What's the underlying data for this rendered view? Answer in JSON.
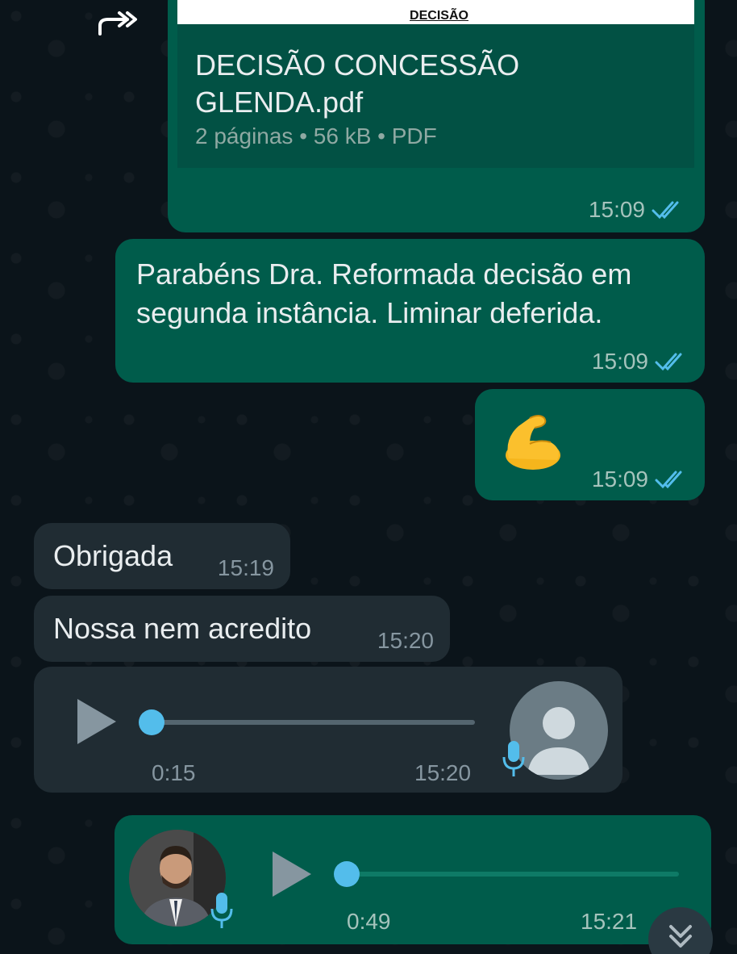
{
  "messages": {
    "document": {
      "preview_title": "DECISÃO",
      "file_name": "DECISÃO CONCESSÃO GLENDA.pdf",
      "meta": "2 páginas • 56 kB • PDF",
      "time": "15:09"
    },
    "text1": {
      "text": "Parabéns Dra. Reformada decisão em segunda instância. Liminar deferida.",
      "time": "15:09"
    },
    "emoji": {
      "emoji_name": "flexed-biceps",
      "time": "15:09"
    },
    "obrigada": {
      "text": "Obrigada",
      "time": "15:19"
    },
    "nossa": {
      "text": "Nossa nem acredito",
      "time": "15:20"
    },
    "voice_in": {
      "duration": "0:15",
      "time": "15:20",
      "progress": 0.0
    },
    "voice_out": {
      "duration": "0:49",
      "time": "15:21",
      "progress": 0.0
    }
  },
  "colors": {
    "outgoing_bubble": "#005c4b",
    "incoming_bubble": "#202c33",
    "read_ticks": "#53bdeb",
    "background": "#0b141a"
  }
}
